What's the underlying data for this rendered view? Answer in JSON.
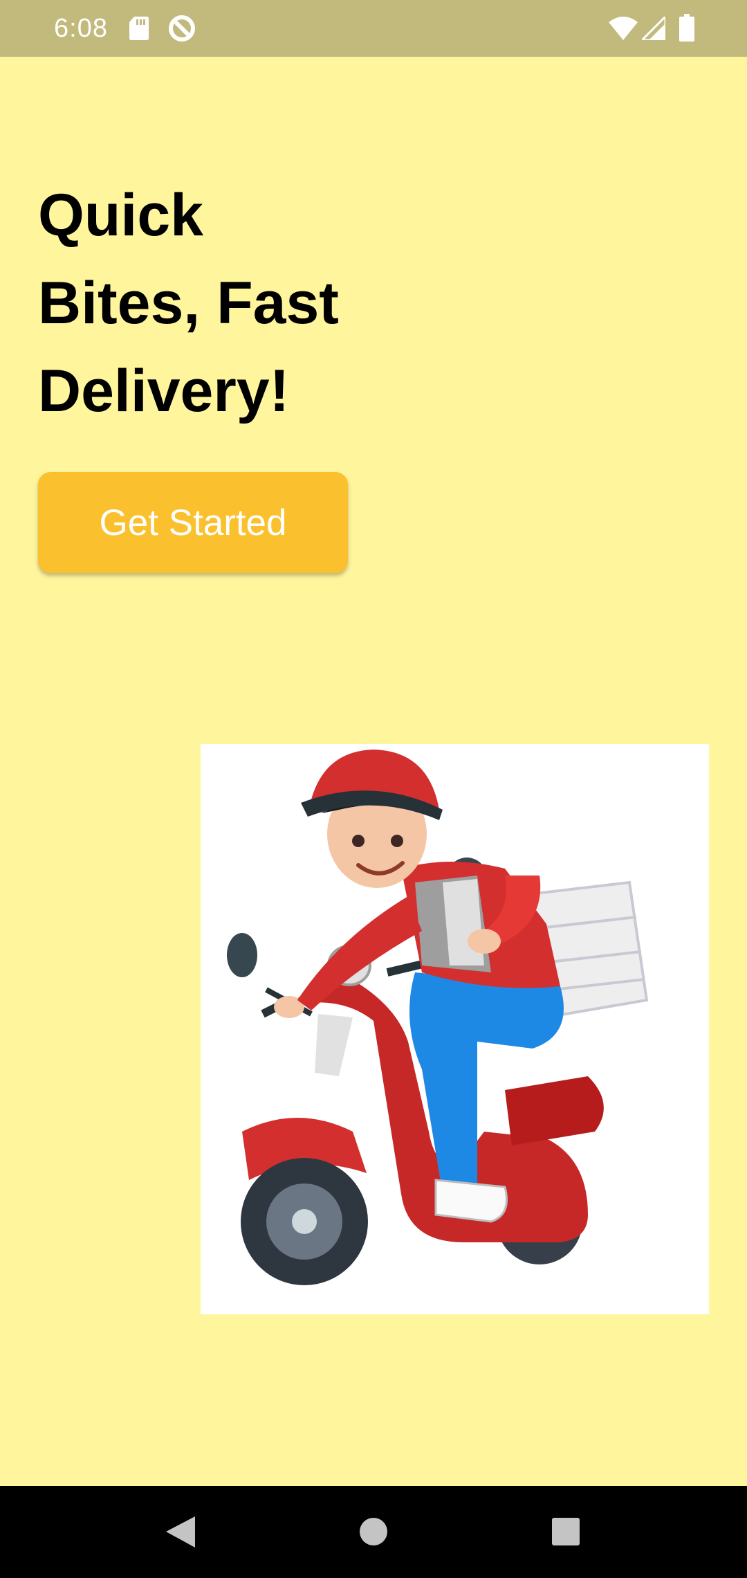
{
  "status_bar": {
    "time": "6:08",
    "icons": [
      "sd-card-icon",
      "data-saver-icon",
      "wifi-icon",
      "signal-icon",
      "battery-icon"
    ]
  },
  "hero": {
    "headline_lines": [
      "Quick",
      "Bites, Fast",
      "Delivery!"
    ],
    "cta_label": "Get Started",
    "illustration": "delivery-rider-on-scooter-illustration"
  },
  "nav_bar": {
    "buttons": [
      "back-icon",
      "home-icon",
      "recents-icon"
    ]
  },
  "colors": {
    "background": "#fff59d",
    "status_bar": "#c2b97d",
    "button": "#fbc02d",
    "button_text": "#ffffff",
    "text": "#000000",
    "nav_bar": "#000000"
  }
}
